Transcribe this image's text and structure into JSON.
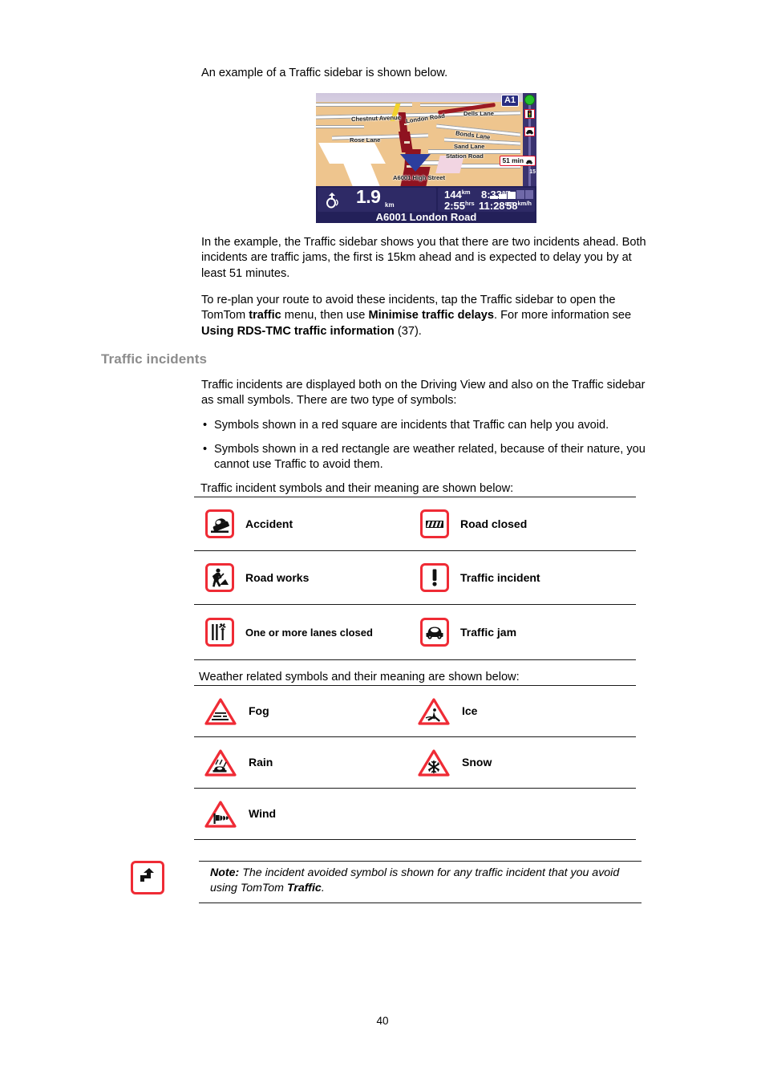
{
  "document": {
    "page_number": "40",
    "intro_line": "An example of a Traffic sidebar is shown below.",
    "paragraph_example": "In the example, the Traffic sidebar shows you that there are two incidents ahead. Both incidents are traffic jams, the first is 15km ahead and is expected to delay you by at least 51 minutes.",
    "paragraph_replan_part1": "To re-plan your route to avoid these incidents, tap the Traffic sidebar to open the TomTom ",
    "paragraph_replan_bold1": "traffic",
    "paragraph_replan_part2": " menu, then use ",
    "paragraph_replan_bold2": "Minimise traffic delays",
    "paragraph_replan_part3": ". For more information see ",
    "paragraph_replan_bold3": "Using RDS-TMC traffic information",
    "paragraph_replan_part4": " (37)."
  },
  "nav_screenshot": {
    "road_badge": "A1",
    "street_labels": [
      "Chestnut Avenue",
      "London Road",
      "Dells Lane",
      "Rose Lane",
      "Bonds Lane",
      "Sand Lane",
      "Station Road",
      "A6001 High Street"
    ],
    "sidebar": {
      "status_dot_color": "#25c02a",
      "delay_label": "51 min",
      "distance_label": "15",
      "icons": [
        "traffic-light-icon",
        "traffic-jam-icon"
      ]
    },
    "status_bar": {
      "next_turn_distance": "1.9",
      "next_turn_distance_unit": "km",
      "remaining_distance": "144",
      "remaining_distance_unit": "km",
      "arrival_time": "8:33",
      "arrival_time_suffix": "am",
      "remaining_time": "2:55",
      "remaining_time_unit": "hrs",
      "clock_time": "11:28",
      "clock_time_suffix": "am",
      "speed": "58",
      "speed_unit": "km/h",
      "street_name": "A6001 London Road"
    }
  },
  "section": {
    "heading": "Traffic incidents",
    "intro": "Traffic incidents are displayed both on the Driving View and also on the Traffic sidebar as small symbols. There are two type of symbols:",
    "bullets": [
      "Symbols shown in a red square are incidents that Traffic can help you avoid.",
      "Symbols shown in a red rectangle are weather related, because of their nature, you cannot use Traffic to avoid them."
    ]
  },
  "incident_table": {
    "caption": "Traffic incident symbols and their meaning are shown below:",
    "rows": [
      [
        {
          "icon": "accident-icon",
          "label": "Accident"
        },
        {
          "icon": "road-closed-icon",
          "label": "Road closed"
        }
      ],
      [
        {
          "icon": "road-works-icon",
          "label": "Road works"
        },
        {
          "icon": "traffic-incident-icon",
          "label": "Traffic incident"
        }
      ],
      [
        {
          "icon": "lanes-closed-icon",
          "label": "One or more lanes closed"
        },
        {
          "icon": "traffic-jam-icon",
          "label": "Traffic jam"
        }
      ]
    ]
  },
  "weather_table": {
    "caption": "Weather related symbols and their meaning are shown below:",
    "rows": [
      [
        {
          "icon": "fog-icon",
          "label": "Fog"
        },
        {
          "icon": "ice-icon",
          "label": "Ice"
        }
      ],
      [
        {
          "icon": "rain-icon",
          "label": "Rain"
        },
        {
          "icon": "snow-icon",
          "label": "Snow"
        }
      ],
      [
        {
          "icon": "wind-icon",
          "label": "Wind"
        },
        {
          "icon": "",
          "label": ""
        }
      ]
    ]
  },
  "note": {
    "icon": "incident-avoided-icon",
    "label": "Note:",
    "text_part1": " The incident avoided symbol is shown for any traffic incident that you avoid using TomTom ",
    "text_bold": "Traffic",
    "text_part2": "."
  },
  "colors": {
    "accent_red": "#ef2b35",
    "heading_gray": "#8c8c8c",
    "nav_panel": "#232059",
    "nav_route": "#8f1320",
    "nav_ground": "#eec58e"
  }
}
